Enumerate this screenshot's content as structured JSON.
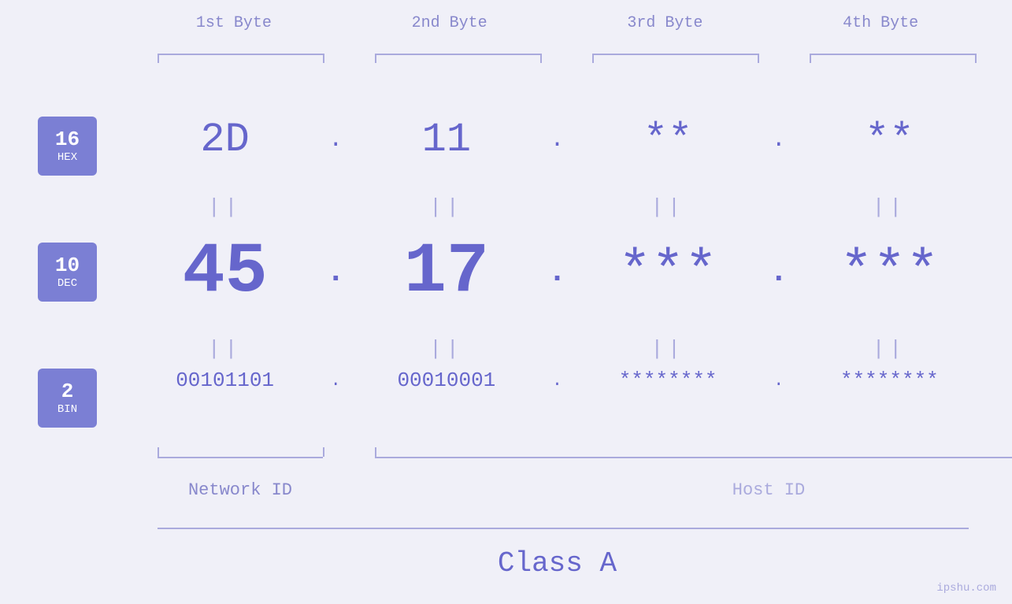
{
  "badges": {
    "hex": {
      "number": "16",
      "label": "HEX"
    },
    "dec": {
      "number": "10",
      "label": "DEC"
    },
    "bin": {
      "number": "2",
      "label": "BIN"
    }
  },
  "column_headers": {
    "b1": "1st Byte",
    "b2": "2nd Byte",
    "b3": "3rd Byte",
    "b4": "4th Byte"
  },
  "hex_row": {
    "b1": "2D",
    "b2": "11",
    "b3": "**",
    "b4": "**",
    "dots": [
      ".",
      ".",
      "."
    ]
  },
  "dec_row": {
    "b1": "45",
    "b2": "17",
    "b3": "***",
    "b4": "***",
    "dots": [
      ".",
      ".",
      "."
    ]
  },
  "bin_row": {
    "b1": "00101101",
    "b2": "00010001",
    "b3": "********",
    "b4": "********",
    "dots": [
      ".",
      ".",
      "."
    ]
  },
  "equals_sign": "||",
  "labels": {
    "network_id": "Network ID",
    "host_id": "Host ID",
    "class": "Class A"
  },
  "watermark": "ipshu.com"
}
